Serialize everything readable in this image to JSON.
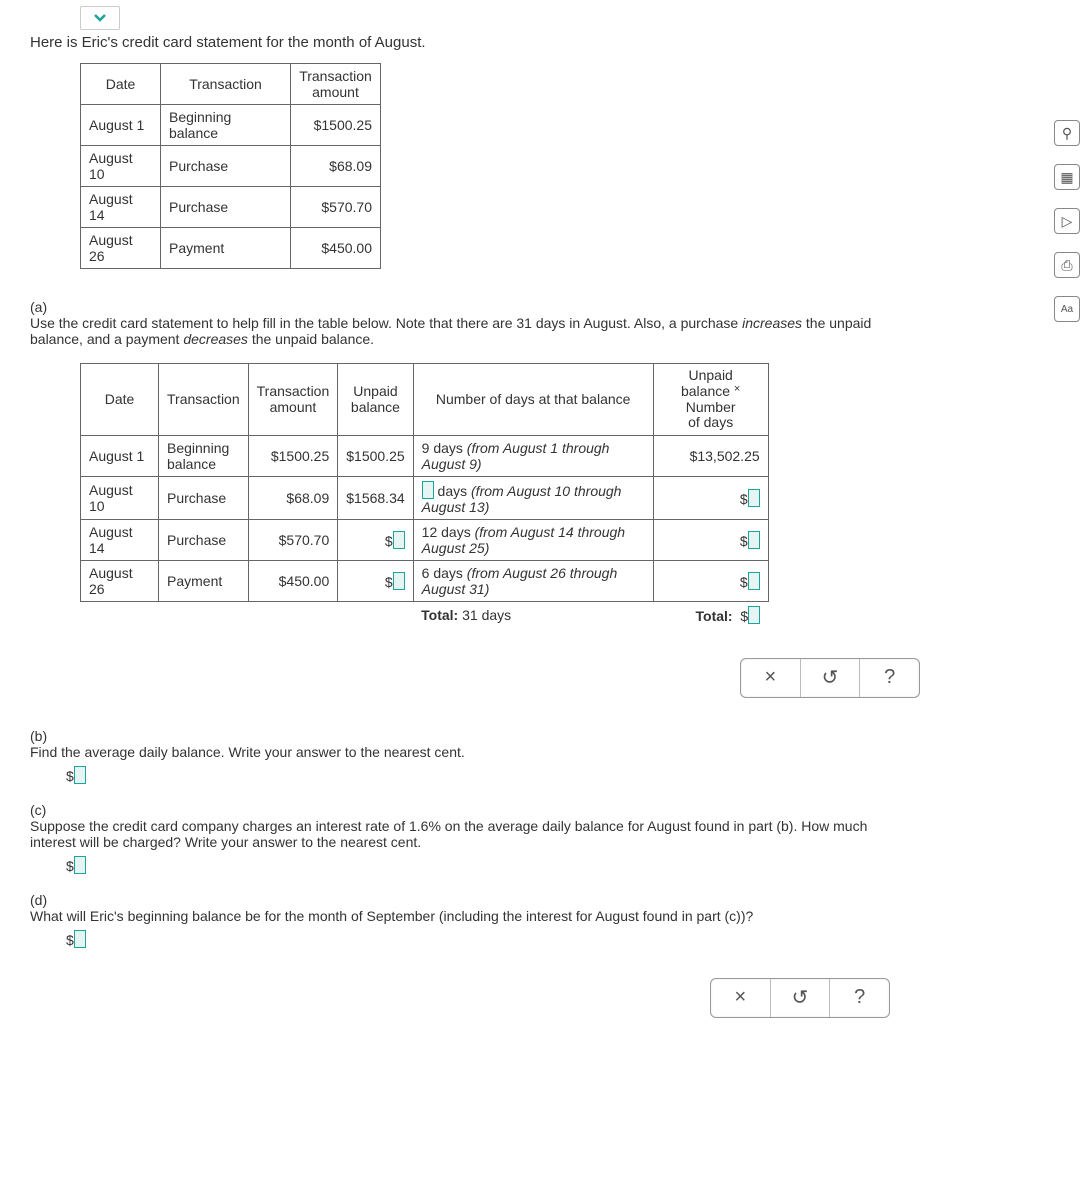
{
  "chevron": "chevron-down",
  "intro": "Here is Eric's credit card statement for the month of August.",
  "statement": {
    "headers": {
      "date": "Date",
      "transaction": "Transaction",
      "amount": "Transaction amount"
    },
    "rows": [
      {
        "date": "August 1",
        "transaction": "Beginning balance",
        "amount": "$1500.25"
      },
      {
        "date": "August 10",
        "transaction": "Purchase",
        "amount": "$68.09"
      },
      {
        "date": "August 14",
        "transaction": "Purchase",
        "amount": "$570.70"
      },
      {
        "date": "August 26",
        "transaction": "Payment",
        "amount": "$450.00"
      }
    ]
  },
  "partA": {
    "label": "(a)",
    "text_pre": "Use the credit card statement to help fill in the table below. Note that there are 31 days in August. Also, a purchase ",
    "text_em1": "increases",
    "text_mid": " the unpaid balance, and a payment ",
    "text_em2": "decreases",
    "text_post": " the unpaid balance."
  },
  "worksheet": {
    "headers": {
      "date": "Date",
      "transaction": "Transaction",
      "amount": "Transaction amount",
      "unpaid": "Unpaid balance",
      "days": "Number of days at that balance",
      "product": "Unpaid balance × Number of days"
    },
    "rows": [
      {
        "date": "August 1",
        "transaction": "Beginning balance",
        "amount": "$1500.25",
        "unpaid": "$1500.25",
        "days_pre": "9 days ",
        "days_em": "(from August 1 through August 9)",
        "product": "$13,502.25"
      },
      {
        "date": "August 10",
        "transaction": "Purchase",
        "amount": "$68.09",
        "unpaid": "$1568.34",
        "days_post": " days ",
        "days_em": "(from August 10 through August 13)"
      },
      {
        "date": "August 14",
        "transaction": "Purchase",
        "amount": "$570.70",
        "days_pre": "12 days ",
        "days_em": "(from August 14 through August 25)"
      },
      {
        "date": "August 26",
        "transaction": "Payment",
        "amount": "$450.00",
        "days_pre": "6 days ",
        "days_em": "(from August 26 through August 31)"
      }
    ],
    "total_days_label": "Total:",
    "total_days_value": " 31 days",
    "total_prod_label": "Total:"
  },
  "partB": {
    "label": "(b)",
    "text": "Find the average daily balance. Write your answer to the nearest cent."
  },
  "partC": {
    "label": "(c)",
    "text": "Suppose the credit card company charges an interest rate of 1.6% on the average daily balance for August found in part (b). How much interest will be charged? Write your answer to the nearest cent."
  },
  "partD": {
    "label": "(d)",
    "text": "What will Eric's beginning balance be for the month of September (including the interest for August found in part (c))?"
  },
  "dollar": "$",
  "actions": {
    "close": "×",
    "reset": "↺",
    "help": "?"
  },
  "side": {
    "explore": "⚲",
    "calc": "▦",
    "play": "▷",
    "print": "⎙",
    "font": "Aa"
  }
}
